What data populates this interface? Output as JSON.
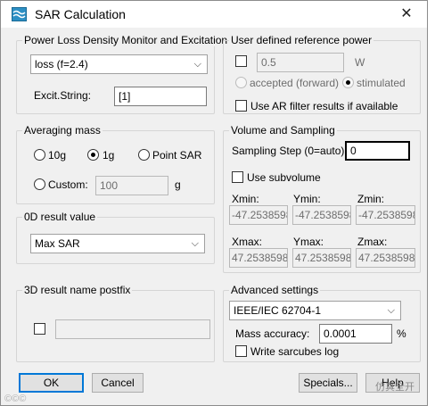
{
  "window": {
    "title": "SAR Calculation",
    "close_glyph": "✕"
  },
  "power_loss": {
    "title": "Power Loss Density Monitor and Excitation",
    "monitor_value": "loss (f=2.4)",
    "excit_label": "Excit.String:",
    "excit_value": "[1]"
  },
  "reference_power": {
    "title": "User defined reference power",
    "enabled": false,
    "value": "0.5",
    "unit": "W",
    "option_accepted": "accepted (forward)",
    "option_stimulated": "stimulated",
    "selected_option": "stimulated",
    "ar_filter_label": "Use AR filter results if available"
  },
  "averaging": {
    "title": "Averaging mass",
    "option_10g": "10g",
    "option_1g": "1g",
    "option_point": "Point SAR",
    "option_custom": "Custom:",
    "selected": "1g",
    "custom_value": "100",
    "custom_unit": "g"
  },
  "result_0d": {
    "title": "0D result value",
    "value": "Max SAR"
  },
  "result_3d": {
    "title": "3D result name postfix",
    "value": ""
  },
  "volume": {
    "title": "Volume and Sampling",
    "sampling_label": "Sampling Step (0=auto):",
    "sampling_value": "0",
    "subvolume_label": "Use subvolume",
    "xmin_label": "Xmin:",
    "ymin_label": "Ymin:",
    "zmin_label": "Zmin:",
    "xmin": "-47.2538598",
    "ymin": "-47.2538598",
    "zmin": "-47.2538598",
    "xmax_label": "Xmax:",
    "ymax_label": "Ymax:",
    "zmax_label": "Zmax:",
    "xmax": "47.25385981",
    "ymax": "47.25385981",
    "zmax": "47.25385981"
  },
  "advanced": {
    "title": "Advanced settings",
    "standard": "IEEE/IEC 62704-1",
    "mass_accuracy_label": "Mass accuracy:",
    "mass_accuracy_value": "0.0001",
    "mass_accuracy_unit": "%",
    "write_sarcubes_label": "Write sarcubes log"
  },
  "buttons": {
    "ok": "OK",
    "cancel": "Cancel",
    "specials": "Specials...",
    "help": "Help"
  },
  "watermark": {
    "left": "©©©",
    "right": "仿真全开"
  }
}
